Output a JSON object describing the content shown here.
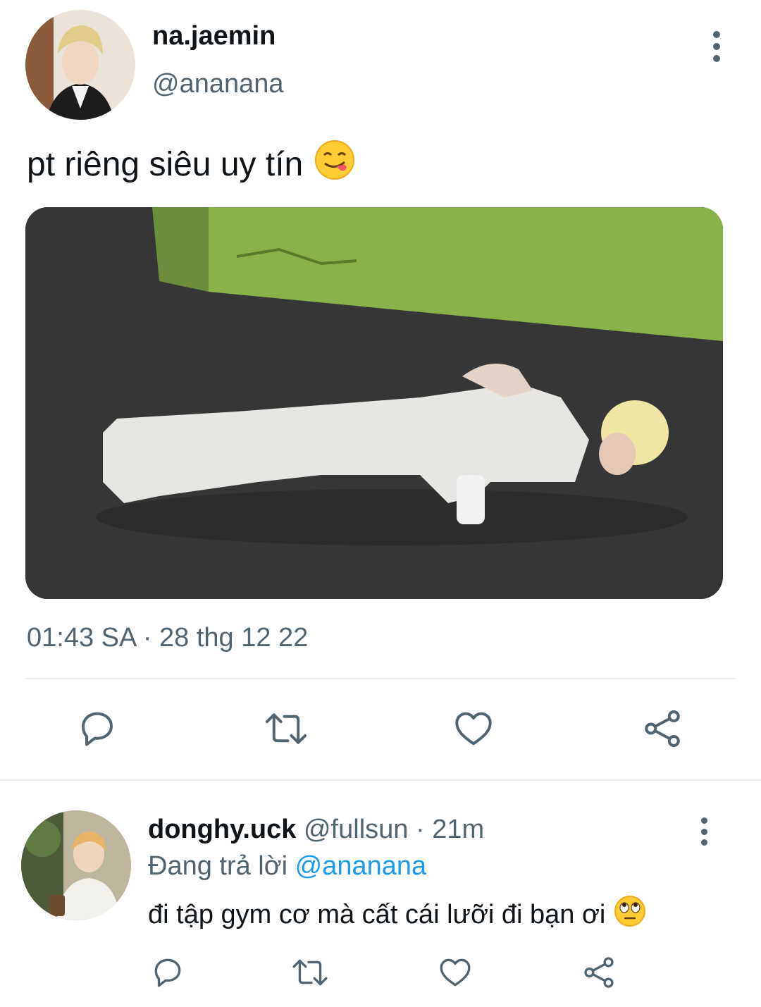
{
  "tweet": {
    "author": {
      "display_name": "na.jaemin",
      "handle": "@ananana"
    },
    "text": "pt riêng siêu uy tín",
    "text_emoji": "yum-tongue-emoji",
    "media": {
      "alt": ""
    },
    "timestamp": "01:43 SA · 28 thg 12 22",
    "actions": [
      "reply-icon",
      "retweet-icon",
      "like-icon",
      "share-icon"
    ]
  },
  "reply": {
    "author": {
      "display_name": "donghy.uck",
      "handle": "@fullsun"
    },
    "time_sep": "·",
    "time": "21m",
    "replying_prefix": "Đang trả lời",
    "replying_to": "@ananana",
    "text": "đi tập gym cơ mà cất cái lưỡi đi bạn ơi",
    "text_emoji": "eye-roll-emoji",
    "actions": [
      "reply-icon",
      "retweet-icon",
      "like-icon",
      "share-icon"
    ]
  },
  "colors": {
    "primary_text": "#0f1419",
    "secondary_text": "#536471",
    "link": "#1d9bf0",
    "icon": "#536471",
    "divider": "#e6ecf0"
  }
}
